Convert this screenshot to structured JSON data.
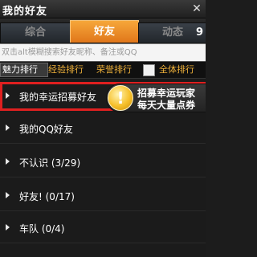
{
  "window": {
    "title": "我的好友",
    "close_label": "✕"
  },
  "tabs": [
    {
      "label": "综合"
    },
    {
      "label": "好友"
    },
    {
      "label": "动态",
      "count": "9"
    }
  ],
  "search": {
    "placeholder": "双击alt模糊搜索好友昵称、备注或QQ"
  },
  "ranks": {
    "charm": "魅力排行",
    "exp": "经验排行",
    "honor": "荣誉排行",
    "all": "全体排行"
  },
  "groups": [
    {
      "label": "我的幸运招募好友"
    },
    {
      "label": "我的QQ好友"
    },
    {
      "label": "不认识 (3/29)"
    },
    {
      "label": "好友! (0/17)"
    },
    {
      "label": "车队 (0/4)"
    }
  ],
  "recruit": {
    "icon": "exclamation-icon",
    "mark": "!",
    "line1": "招募幸运玩家",
    "line2": "每天大量点券"
  }
}
